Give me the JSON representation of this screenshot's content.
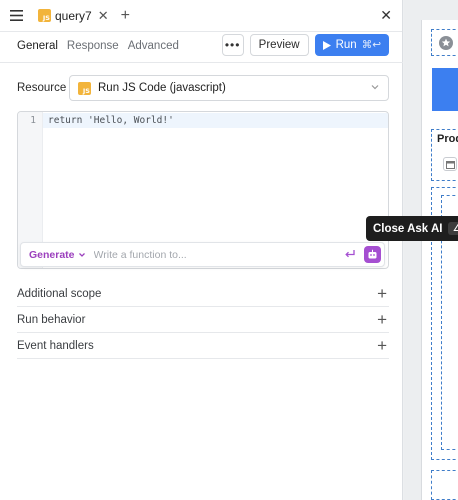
{
  "tab": {
    "name": "query7",
    "badge": "JS"
  },
  "subtabs": [
    "General",
    "Response",
    "Advanced"
  ],
  "actions": {
    "more": "•••",
    "preview": "Preview",
    "run": "Run",
    "run_shortcut": "⌘↩"
  },
  "resource": {
    "label": "Resource",
    "value": "Run JS Code (javascript)",
    "badge": "JS"
  },
  "editor": {
    "line_number": "1",
    "code": "return 'Hello, World!'"
  },
  "ai": {
    "generate_label": "Generate",
    "placeholder": "Write a function to..."
  },
  "sections": [
    "Additional scope",
    "Run behavior",
    "Event handlers"
  ],
  "tooltip": {
    "text": "Close Ask AI",
    "shortcut": "∠"
  },
  "canvas": {
    "partial_label": "Prod"
  },
  "colors": {
    "accent": "#3c7ff0",
    "js_badge": "#f2b43b",
    "ai_purple": "#9b3fbd"
  }
}
